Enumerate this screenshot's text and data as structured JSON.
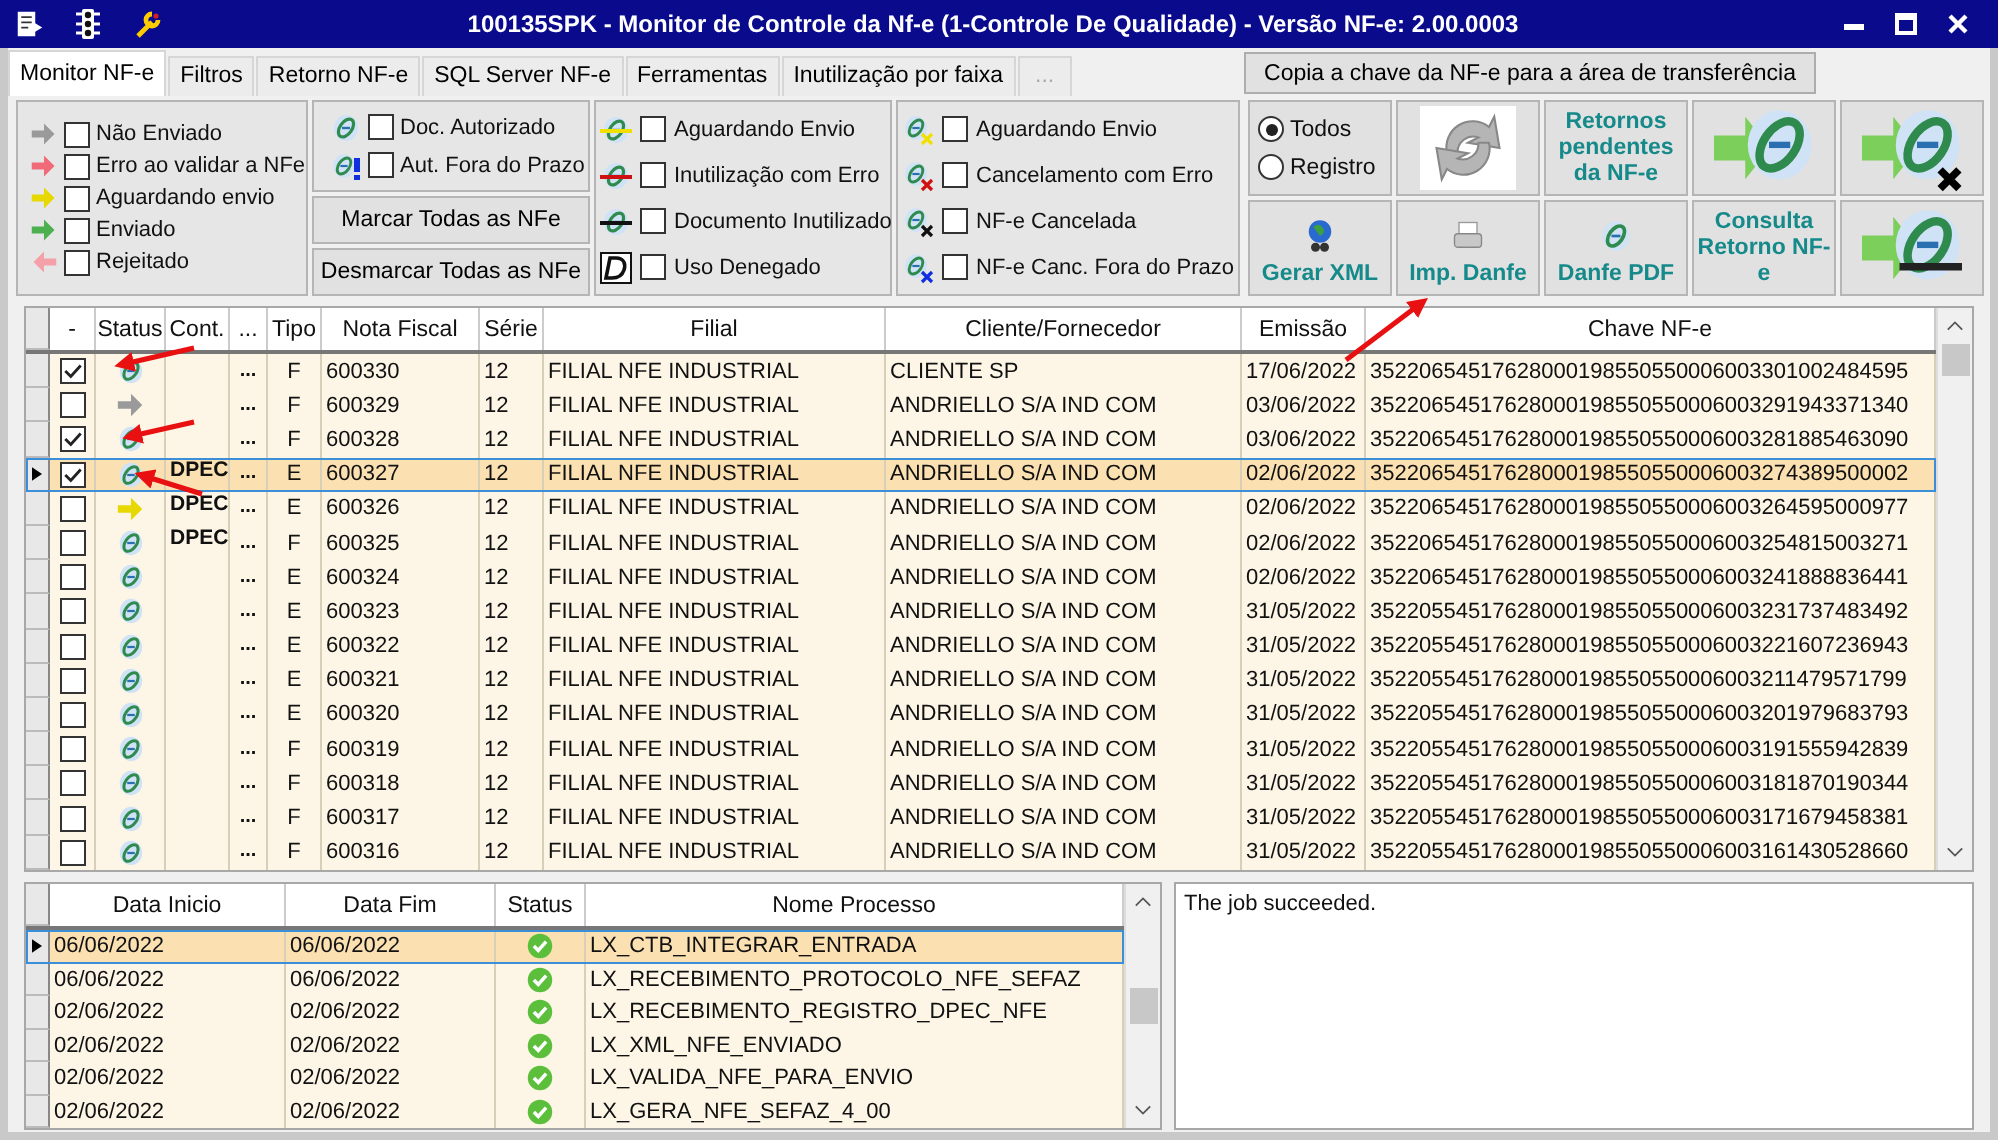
{
  "window": {
    "title": "100135SPK - Monitor de Controle da Nf-e (1-Controle De Qualidade) - Versão NF-e: 2.00.0003"
  },
  "tabs": [
    {
      "label": "Monitor NF-e",
      "selected": true,
      "disabled": false
    },
    {
      "label": "Filtros",
      "selected": false,
      "disabled": false
    },
    {
      "label": "Retorno NF-e",
      "selected": false,
      "disabled": false
    },
    {
      "label": "SQL Server NF-e",
      "selected": false,
      "disabled": false
    },
    {
      "label": "Ferramentas",
      "selected": false,
      "disabled": false
    },
    {
      "label": "Inutilização por faixa",
      "selected": false,
      "disabled": false
    },
    {
      "label": "...",
      "selected": false,
      "disabled": true
    }
  ],
  "copy_button": "Copia a chave da NF-e para a área de transferência",
  "status_legend": [
    {
      "kind": "grey",
      "label": "Não Enviado",
      "checked": false
    },
    {
      "kind": "red",
      "label": "Erro ao validar a NFe",
      "checked": false
    },
    {
      "kind": "yellow",
      "label": "Aguardando envio",
      "checked": false
    },
    {
      "kind": "green",
      "label": "Enviado",
      "checked": false
    },
    {
      "kind": "back",
      "label": "Rejeitado",
      "checked": false
    }
  ],
  "authorization_legend": [
    {
      "kind": "authorized",
      "label": "Doc. Autorizado",
      "checked": false
    },
    {
      "kind": "late",
      "label": "Aut. Fora do Prazo",
      "checked": false
    }
  ],
  "mark_buttons": [
    "Marcar Todas as NFe",
    "Desmarcar Todas as NFe"
  ],
  "inutilization_legend": [
    {
      "kind": "pending",
      "label": "Aguardando Envio",
      "checked": false
    },
    {
      "kind": "error",
      "label": "Inutilização com Erro",
      "checked": false
    },
    {
      "kind": "done",
      "label": "Documento Inutilizado",
      "checked": false
    },
    {
      "kind": "denied",
      "label": "Uso Denegado",
      "checked": false
    }
  ],
  "cancel_legend": [
    {
      "kind": "pending",
      "label": "Aguardando Envio",
      "checked": false
    },
    {
      "kind": "error",
      "label": "Cancelamento com Erro",
      "checked": false
    },
    {
      "kind": "done",
      "label": "NF-e Cancelada",
      "checked": false
    },
    {
      "kind": "late",
      "label": "NF-e Canc. Fora do Prazo",
      "checked": false
    }
  ],
  "filter_radios": [
    {
      "label": "Todos",
      "selected": true
    },
    {
      "label": "Registro",
      "selected": false
    }
  ],
  "action_buttons": [
    {
      "kind": "refresh"
    },
    {
      "kind": "text",
      "label": "Retornos pendentes da NF-e"
    },
    {
      "kind": "send"
    },
    {
      "kind": "cancel"
    },
    {
      "kind": "xml",
      "label": "Gerar XML"
    },
    {
      "kind": "print",
      "label": "Imp. Danfe"
    },
    {
      "kind": "pdf",
      "label": "Danfe PDF"
    },
    {
      "kind": "text",
      "label": "Consulta Retorno NF-e"
    },
    {
      "kind": "inutilize"
    }
  ],
  "nfe_table": {
    "columns": [
      "-",
      "Status",
      "Cont.",
      "...",
      "Tipo",
      "Nota Fiscal",
      "Série",
      "Filial",
      "Cliente/Fornecedor",
      "Emissão",
      "Chave NF-e"
    ],
    "rows": [
      {
        "selected": false,
        "checked": true,
        "kind": "authorized",
        "cont": "",
        "more": "...",
        "tipo": "F",
        "nota": "600330",
        "serie": "12",
        "filial": "FILIAL NFE INDUSTRIAL",
        "cliente": "CLIENTE SP",
        "emissao": "17/06/2022",
        "chave": "35220654517628000198550550006003301002484595"
      },
      {
        "selected": false,
        "checked": false,
        "kind": "unsent",
        "cont": "",
        "more": "...",
        "tipo": "F",
        "nota": "600329",
        "serie": "12",
        "filial": "FILIAL NFE INDUSTRIAL",
        "cliente": "ANDRIELLO S/A IND COM",
        "emissao": "03/06/2022",
        "chave": "35220654517628000198550550006003291943371340"
      },
      {
        "selected": false,
        "checked": true,
        "kind": "authorized",
        "cont": "",
        "more": "...",
        "tipo": "F",
        "nota": "600328",
        "serie": "12",
        "filial": "FILIAL NFE INDUSTRIAL",
        "cliente": "ANDRIELLO S/A IND COM",
        "emissao": "03/06/2022",
        "chave": "35220654517628000198550550006003281885463090"
      },
      {
        "selected": true,
        "checked": true,
        "kind": "authorized",
        "cont": "DPEC",
        "more": "...",
        "tipo": "E",
        "nota": "600327",
        "serie": "12",
        "filial": "FILIAL NFE INDUSTRIAL",
        "cliente": "ANDRIELLO S/A IND COM",
        "emissao": "02/06/2022",
        "chave": "35220654517628000198550550006003274389500002"
      },
      {
        "selected": false,
        "checked": false,
        "kind": "waiting",
        "cont": "DPEC",
        "more": "...",
        "tipo": "E",
        "nota": "600326",
        "serie": "12",
        "filial": "FILIAL NFE INDUSTRIAL",
        "cliente": "ANDRIELLO S/A IND COM",
        "emissao": "02/06/2022",
        "chave": "35220654517628000198550550006003264595000977"
      },
      {
        "selected": false,
        "checked": false,
        "kind": "authorized",
        "cont": "DPEC",
        "more": "...",
        "tipo": "F",
        "nota": "600325",
        "serie": "12",
        "filial": "FILIAL NFE INDUSTRIAL",
        "cliente": "ANDRIELLO S/A IND COM",
        "emissao": "02/06/2022",
        "chave": "35220654517628000198550550006003254815003271"
      },
      {
        "selected": false,
        "checked": false,
        "kind": "authorized",
        "cont": "",
        "more": "...",
        "tipo": "E",
        "nota": "600324",
        "serie": "12",
        "filial": "FILIAL NFE INDUSTRIAL",
        "cliente": "ANDRIELLO S/A IND COM",
        "emissao": "02/06/2022",
        "chave": "35220654517628000198550550006003241888836441"
      },
      {
        "selected": false,
        "checked": false,
        "kind": "authorized",
        "cont": "",
        "more": "...",
        "tipo": "E",
        "nota": "600323",
        "serie": "12",
        "filial": "FILIAL NFE INDUSTRIAL",
        "cliente": "ANDRIELLO S/A IND COM",
        "emissao": "31/05/2022",
        "chave": "35220554517628000198550550006003231737483492"
      },
      {
        "selected": false,
        "checked": false,
        "kind": "authorized",
        "cont": "",
        "more": "...",
        "tipo": "E",
        "nota": "600322",
        "serie": "12",
        "filial": "FILIAL NFE INDUSTRIAL",
        "cliente": "ANDRIELLO S/A IND COM",
        "emissao": "31/05/2022",
        "chave": "35220554517628000198550550006003221607236943"
      },
      {
        "selected": false,
        "checked": false,
        "kind": "authorized",
        "cont": "",
        "more": "...",
        "tipo": "E",
        "nota": "600321",
        "serie": "12",
        "filial": "FILIAL NFE INDUSTRIAL",
        "cliente": "ANDRIELLO S/A IND COM",
        "emissao": "31/05/2022",
        "chave": "35220554517628000198550550006003211479571799"
      },
      {
        "selected": false,
        "checked": false,
        "kind": "authorized",
        "cont": "",
        "more": "...",
        "tipo": "E",
        "nota": "600320",
        "serie": "12",
        "filial": "FILIAL NFE INDUSTRIAL",
        "cliente": "ANDRIELLO S/A IND COM",
        "emissao": "31/05/2022",
        "chave": "35220554517628000198550550006003201979683793"
      },
      {
        "selected": false,
        "checked": false,
        "kind": "authorized",
        "cont": "",
        "more": "...",
        "tipo": "F",
        "nota": "600319",
        "serie": "12",
        "filial": "FILIAL NFE INDUSTRIAL",
        "cliente": "ANDRIELLO S/A IND COM",
        "emissao": "31/05/2022",
        "chave": "35220554517628000198550550006003191555942839"
      },
      {
        "selected": false,
        "checked": false,
        "kind": "authorized",
        "cont": "",
        "more": "...",
        "tipo": "F",
        "nota": "600318",
        "serie": "12",
        "filial": "FILIAL NFE INDUSTRIAL",
        "cliente": "ANDRIELLO S/A IND COM",
        "emissao": "31/05/2022",
        "chave": "35220554517628000198550550006003181870190344"
      },
      {
        "selected": false,
        "checked": false,
        "kind": "authorized",
        "cont": "",
        "more": "...",
        "tipo": "F",
        "nota": "600317",
        "serie": "12",
        "filial": "FILIAL NFE INDUSTRIAL",
        "cliente": "ANDRIELLO S/A IND COM",
        "emissao": "31/05/2022",
        "chave": "35220554517628000198550550006003171679458381"
      },
      {
        "selected": false,
        "checked": false,
        "kind": "authorized",
        "cont": "",
        "more": "...",
        "tipo": "F",
        "nota": "600316",
        "serie": "12",
        "filial": "FILIAL NFE INDUSTRIAL",
        "cliente": "ANDRIELLO S/A IND COM",
        "emissao": "31/05/2022",
        "chave": "35220554517628000198550550006003161430528660"
      }
    ]
  },
  "job_table": {
    "columns": [
      "Data Inicio",
      "Data Fim",
      "Status",
      "Nome Processo"
    ],
    "rows": [
      {
        "selected": true,
        "data_inicio": "06/06/2022",
        "data_fim": "06/06/2022",
        "kind": "success",
        "nome_processo": "LX_CTB_INTEGRAR_ENTRADA"
      },
      {
        "selected": false,
        "data_inicio": "06/06/2022",
        "data_fim": "06/06/2022",
        "kind": "success",
        "nome_processo": "LX_RECEBIMENTO_PROTOCOLO_NFE_SEFAZ"
      },
      {
        "selected": false,
        "data_inicio": "02/06/2022",
        "data_fim": "02/06/2022",
        "kind": "success",
        "nome_processo": "LX_RECEBIMENTO_REGISTRO_DPEC_NFE"
      },
      {
        "selected": false,
        "data_inicio": "02/06/2022",
        "data_fim": "02/06/2022",
        "kind": "success",
        "nome_processo": "LX_XML_NFE_ENVIADO"
      },
      {
        "selected": false,
        "data_inicio": "02/06/2022",
        "data_fim": "02/06/2022",
        "kind": "success",
        "nome_processo": "LX_VALIDA_NFE_PARA_ENVIO"
      },
      {
        "selected": false,
        "data_inicio": "02/06/2022",
        "data_fim": "02/06/2022",
        "kind": "success",
        "nome_processo": "LX_GERA_NFE_SEFAZ_4_00"
      }
    ]
  },
  "job_message": "The job succeeded."
}
